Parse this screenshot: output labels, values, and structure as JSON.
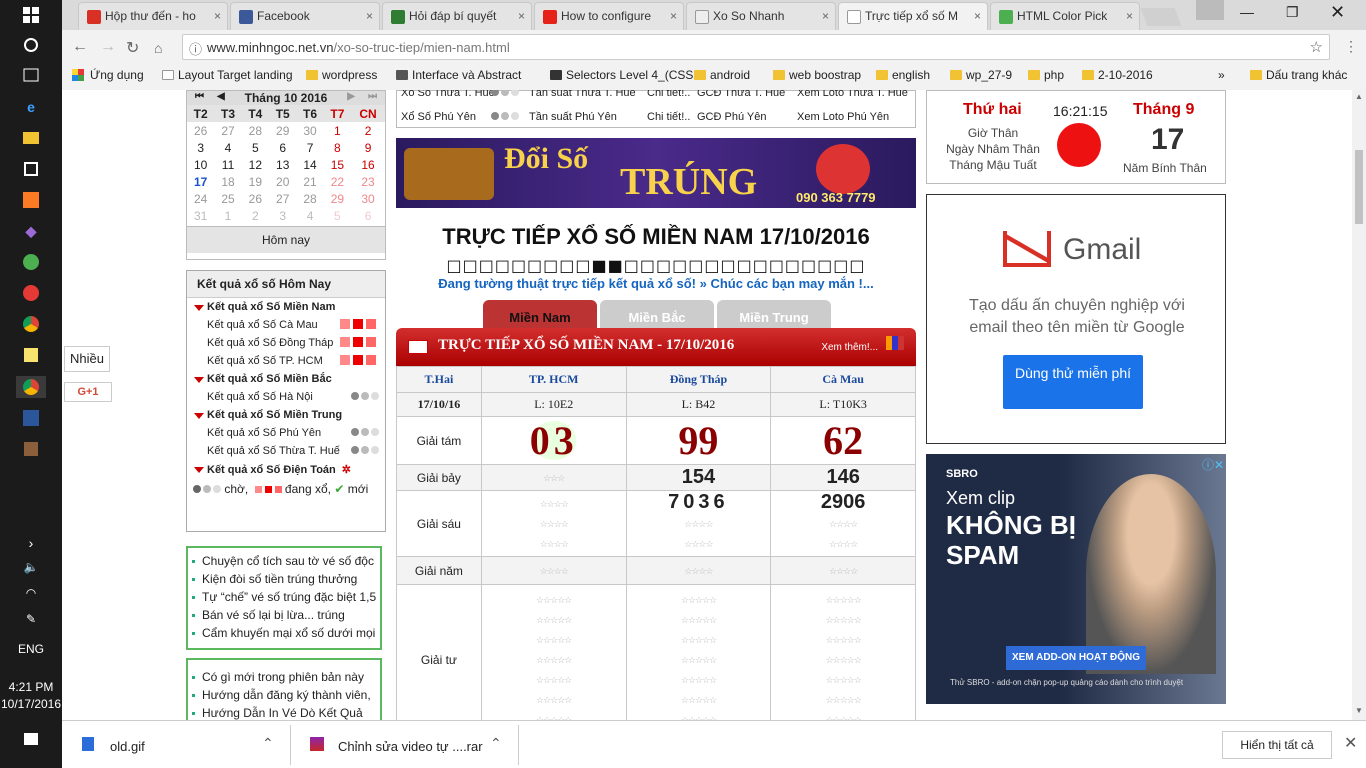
{
  "taskbar": {
    "time": "4:21 PM",
    "date": "10/17/2016",
    "lang": "ENG"
  },
  "tabs": [
    {
      "label": "Hộp thư đến - ho",
      "icon": "gmail-icon",
      "color": "#d93025"
    },
    {
      "label": "Facebook",
      "icon": "facebook-icon",
      "color": "#3b5998"
    },
    {
      "label": "Hỏi đáp bí quyết",
      "icon": "d-icon",
      "color": "#2e7d32"
    },
    {
      "label": "How to configure",
      "icon": "youtube-icon",
      "color": "#e62117"
    },
    {
      "label": "Xo So Nhanh",
      "icon": "page-icon",
      "color": "#888888"
    },
    {
      "label": "Trực tiếp xổ số M",
      "icon": "page-icon",
      "color": "#888888"
    },
    {
      "label": "HTML Color Pick",
      "icon": "w3-icon",
      "color": "#4caf50"
    }
  ],
  "address": {
    "host": "www.minhngoc.net.vn",
    "path": "/xo-so-truc-tiep/mien-nam.html"
  },
  "bookmarks": [
    "Ứng dụng",
    "Layout Target landing",
    "wordpress",
    "Interface và Abstract",
    "Selectors Level 4_(CSS",
    "android",
    "web boostrap",
    "english",
    "wp_27-9",
    "php",
    "2-10-2016"
  ],
  "bookmarks_more": "Dấu trang khác",
  "calendar": {
    "title": "Tháng 10 2016",
    "headers": [
      "T2",
      "T3",
      "T4",
      "T5",
      "T6",
      "T7",
      "CN"
    ],
    "rows": [
      [
        "26",
        "27",
        "28",
        "29",
        "30",
        "1",
        "2"
      ],
      [
        "3",
        "4",
        "5",
        "6",
        "7",
        "8",
        "9"
      ],
      [
        "10",
        "11",
        "12",
        "13",
        "14",
        "15",
        "16"
      ],
      [
        "17",
        "18",
        "19",
        "20",
        "21",
        "22",
        "23"
      ],
      [
        "24",
        "25",
        "26",
        "27",
        "28",
        "29",
        "30"
      ],
      [
        "31",
        "1",
        "2",
        "3",
        "4",
        "5",
        "6"
      ]
    ],
    "footer": "Hôm nay"
  },
  "sidebar_share": {
    "label": "Nhiều",
    "gplus": "G+1"
  },
  "today_box": {
    "title": "Kết quả xổ số Hôm Nay",
    "items": [
      {
        "label": "Kết quả xổ Số Miền Nam",
        "head": true
      },
      {
        "label": "Kết quả xổ Số Cà Mau",
        "status": "red"
      },
      {
        "label": "Kết quả xổ Số Đồng Tháp",
        "status": "red"
      },
      {
        "label": "Kết quả xổ Số TP. HCM",
        "status": "red"
      },
      {
        "label": "Kết quả xổ Số Miền Bắc",
        "head": true
      },
      {
        "label": "Kết quả xổ Số Hà Nội",
        "status": "grey"
      },
      {
        "label": "Kết quả xổ Số Miền Trung",
        "head": true
      },
      {
        "label": "Kết quả xổ Số Phú Yên",
        "status": "grey"
      },
      {
        "label": "Kết quả xổ Số Thừa T. Huế",
        "status": "grey"
      },
      {
        "label": "Kết quả xổ Số Điện Toán",
        "head": true
      }
    ],
    "legend": [
      "chờ,",
      "đang xổ,",
      "mới"
    ]
  },
  "news1": [
    "Chuyện cổ tích sau tờ vé số độc",
    "Kiện đòi số tiền trúng thưởng",
    "Tự “chế” vé số trúng đặc biệt 1,5",
    "Bán vé số lại bị lừa... trúng",
    "Cẩm khuyến mại xổ số dưới mọi"
  ],
  "news2": [
    "Có gì mới trong phiên bản này",
    "Hướng dẫn đăng ký thành viên,",
    "Hướng Dẫn In Vé Dò Kết Quả"
  ],
  "top_table": [
    [
      "Xổ Số Thừa T. Huế",
      "Tần suất Thừa T. Huế",
      "Chi tiết!..",
      "GCĐ Thừa T. Huế",
      "Xem Loto Thừa T. Huế"
    ],
    [
      "Xổ Số Phú Yên",
      "Tần suất Phú Yên",
      "Chi tiết!..",
      "GCĐ Phú Yên",
      "Xem Loto Phú Yên"
    ]
  ],
  "banner": {
    "line1": "Đổi Số",
    "line2": "TRÚNG",
    "phone": "090 363 7779"
  },
  "main": {
    "title": "TRỰC TIẾP XỔ SỐ MIỀN NAM 17/10/2016",
    "progress": "□□□□□□□□□■■□□□□□□□□□□□□□□□",
    "tagline": "Đang tường thuật trực tiếp kết quả xổ số! » Chúc các bạn may mắn !...",
    "tabs": [
      "Miền Nam",
      "Miền Bắc",
      "Miền Trung"
    ],
    "bar_title": "TRỰC TIẾP XỔ SỐ MIỀN NAM - 17/10/2016",
    "more": "Xem thêm!..."
  },
  "results": {
    "header": [
      "T.Hai",
      "TP. HCM",
      "Đồng Tháp",
      "Cà Mau"
    ],
    "dates": [
      "17/10/16",
      "L: 10E2",
      "L: B42",
      "L: T10K3"
    ],
    "giai_tam": {
      "label": "Giải tám",
      "values": [
        "03",
        "99",
        "62"
      ]
    },
    "giai_bay": {
      "label": "Giải bảy",
      "values": [
        "",
        "154",
        "146"
      ]
    },
    "giai_sau": {
      "label": "Giải sáu",
      "values": [
        "",
        "7036",
        "2906"
      ]
    },
    "giai_nam": {
      "label": "Giải năm"
    },
    "giai_tu": {
      "label": "Giải tư"
    }
  },
  "lunar": {
    "day": "Thứ hai",
    "time": "16:21:15",
    "month": "Tháng 9",
    "date": "17",
    "gio": "Giờ Thân",
    "ngay": "Ngày Nhâm Thân",
    "thang": "Tháng Mậu Tuất",
    "nam": "Năm Bính Thân"
  },
  "gmail_ad": {
    "brand": "Gmail",
    "text": "Tạo dấu ấn chuyên nghiệp với email theo tên miền từ Google",
    "button": "Dùng thử miễn phí"
  },
  "sbro_ad": {
    "brand": "SBRO",
    "l1": "Xem clip",
    "l2": "KHÔNG BỊ",
    "l3": "SPAM",
    "button": "XEM ADD-ON HOẠT ĐỘNG",
    "foot": "Thử SBRO - add-on chặn pop-up quảng cáo dành cho trình duyệt"
  },
  "downloads": [
    {
      "name": "old.gif"
    },
    {
      "name": "Chỉnh sửa video tự ....rar"
    }
  ],
  "downloads_show_all": "Hiển thị tất cả"
}
